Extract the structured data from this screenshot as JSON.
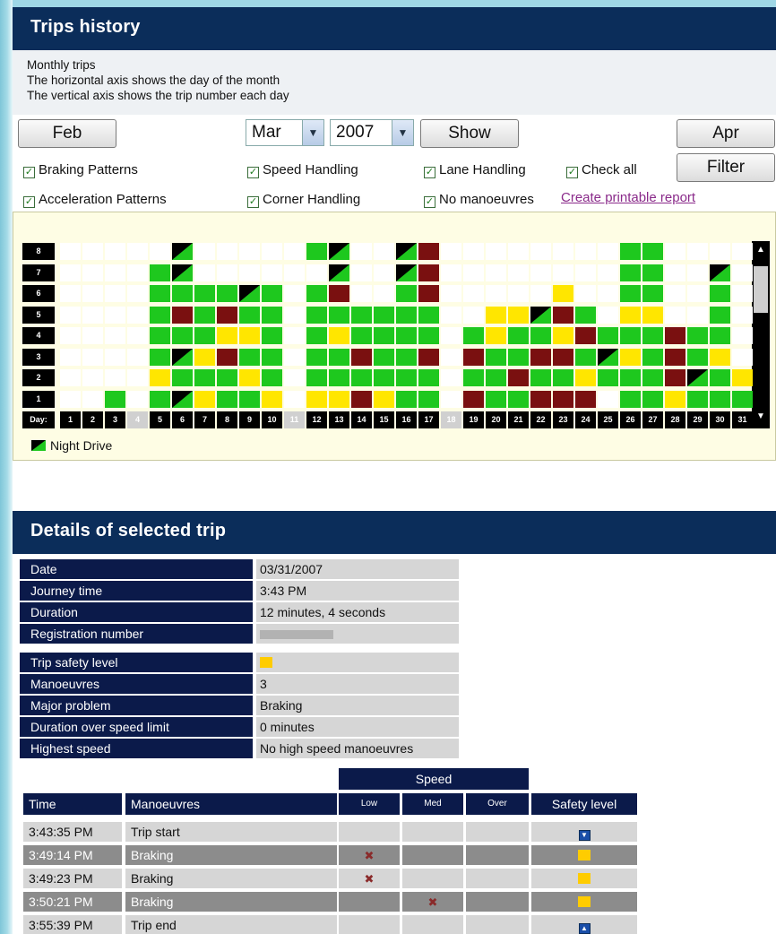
{
  "trips_history": {
    "title": "Trips history",
    "intro": [
      "Monthly trips",
      "The horizontal axis shows the day of the month",
      "The vertical axis shows the trip number each day"
    ],
    "prev_button": "Feb",
    "month": "Mar",
    "year": "2007",
    "show_button": "Show",
    "next_button": "Apr",
    "filter_button": "Filter",
    "checkboxes": [
      {
        "label": "Braking Patterns",
        "checked": true
      },
      {
        "label": "Speed Handling",
        "checked": true
      },
      {
        "label": "Lane Handling",
        "checked": true
      },
      {
        "label": "Check all",
        "checked": true
      },
      {
        "label": "Acceleration Patterns",
        "checked": true
      },
      {
        "label": "Corner Handling",
        "checked": true
      },
      {
        "label": "No manoeuvres",
        "checked": true
      }
    ],
    "printable_link": "Create printable report",
    "legend_night": "Night Drive",
    "day_axis_label": "Day:",
    "row_numbers": [
      "1",
      "2",
      "3",
      "4",
      "5",
      "6",
      "7",
      "8"
    ],
    "days": [
      "1",
      "2",
      "3",
      "4",
      "5",
      "6",
      "7",
      "8",
      "9",
      "10",
      "11",
      "12",
      "13",
      "14",
      "15",
      "16",
      "17",
      "18",
      "19",
      "20",
      "21",
      "22",
      "23",
      "24",
      "25",
      "26",
      "27",
      "28",
      "29",
      "30",
      "31"
    ],
    "colors": {
      "green": "#1ec81e",
      "yellow": "#ffe600",
      "red": "#7a1010",
      "grey_day": "#d0d0d0",
      "empty": "#ffffff"
    },
    "trips_grid": {
      "legend": "G=green, Y=yellow, R=red, N suffix=night drive, -=no trip",
      "days": [
        "--------",
        "--------",
        "G-------",
        "--------",
        "GYGGGGG-",
        "NGNGRGNN",
        "YGYGGG--",
        "GGRYRG--",
        "GYGYGN--",
        "YGGGGG--",
        "--------",
        "YGGGGG-G",
        "YGGYGRNN",
        "RGRGG---",
        "YGGGG---",
        "GGGGGGNN",
        "GGRGGRRR",
        "--------",
        "RGRG----",
        "GGGYY---",
        "GRGGY---",
        "RGRGN---",
        "RGRYRY--",
        "RYGRG---",
        "-GNG----",
        "GGYGYGGG",
        "GGGGYGGG",
        "YRRR----",
        "GNGG----",
        "GGYGGGN-",
        "GY------"
      ]
    }
  },
  "details": {
    "title": "Details of selected trip",
    "rows_1": [
      {
        "label": "Date",
        "value": "03/31/2007"
      },
      {
        "label": "Journey time",
        "value": "3:43 PM"
      },
      {
        "label": "Duration",
        "value": "12 minutes, 4 seconds"
      },
      {
        "label": "Registration number",
        "value": ""
      }
    ],
    "rows_2": [
      {
        "label": "Trip safety level",
        "value": ""
      },
      {
        "label": "Manoeuvres",
        "value": "3"
      },
      {
        "label": "Major problem",
        "value": "Braking"
      },
      {
        "label": "Duration over speed limit",
        "value": "0 minutes"
      },
      {
        "label": "Highest speed",
        "value": "No high speed manoeuvres"
      }
    ],
    "table": {
      "speed_header": "Speed",
      "headers": [
        "Time",
        "Manoeuvres",
        "Low",
        "Med",
        "Over",
        "Safety level"
      ],
      "rows": [
        {
          "time": "3:43:35 PM",
          "manoeuvre": "Trip start",
          "low": "",
          "med": "",
          "over": "",
          "safety": "start-icon"
        },
        {
          "time": "3:49:14 PM",
          "manoeuvre": "Braking",
          "low": "✖",
          "med": "",
          "over": "",
          "safety": "yellow"
        },
        {
          "time": "3:49:23 PM",
          "manoeuvre": "Braking",
          "low": "✖",
          "med": "",
          "over": "",
          "safety": "yellow"
        },
        {
          "time": "3:50:21 PM",
          "manoeuvre": "Braking",
          "low": "",
          "med": "✖",
          "over": "",
          "safety": "yellow"
        },
        {
          "time": "3:55:39 PM",
          "manoeuvre": "Trip end",
          "low": "",
          "med": "",
          "over": "",
          "safety": "end-icon"
        }
      ]
    }
  }
}
